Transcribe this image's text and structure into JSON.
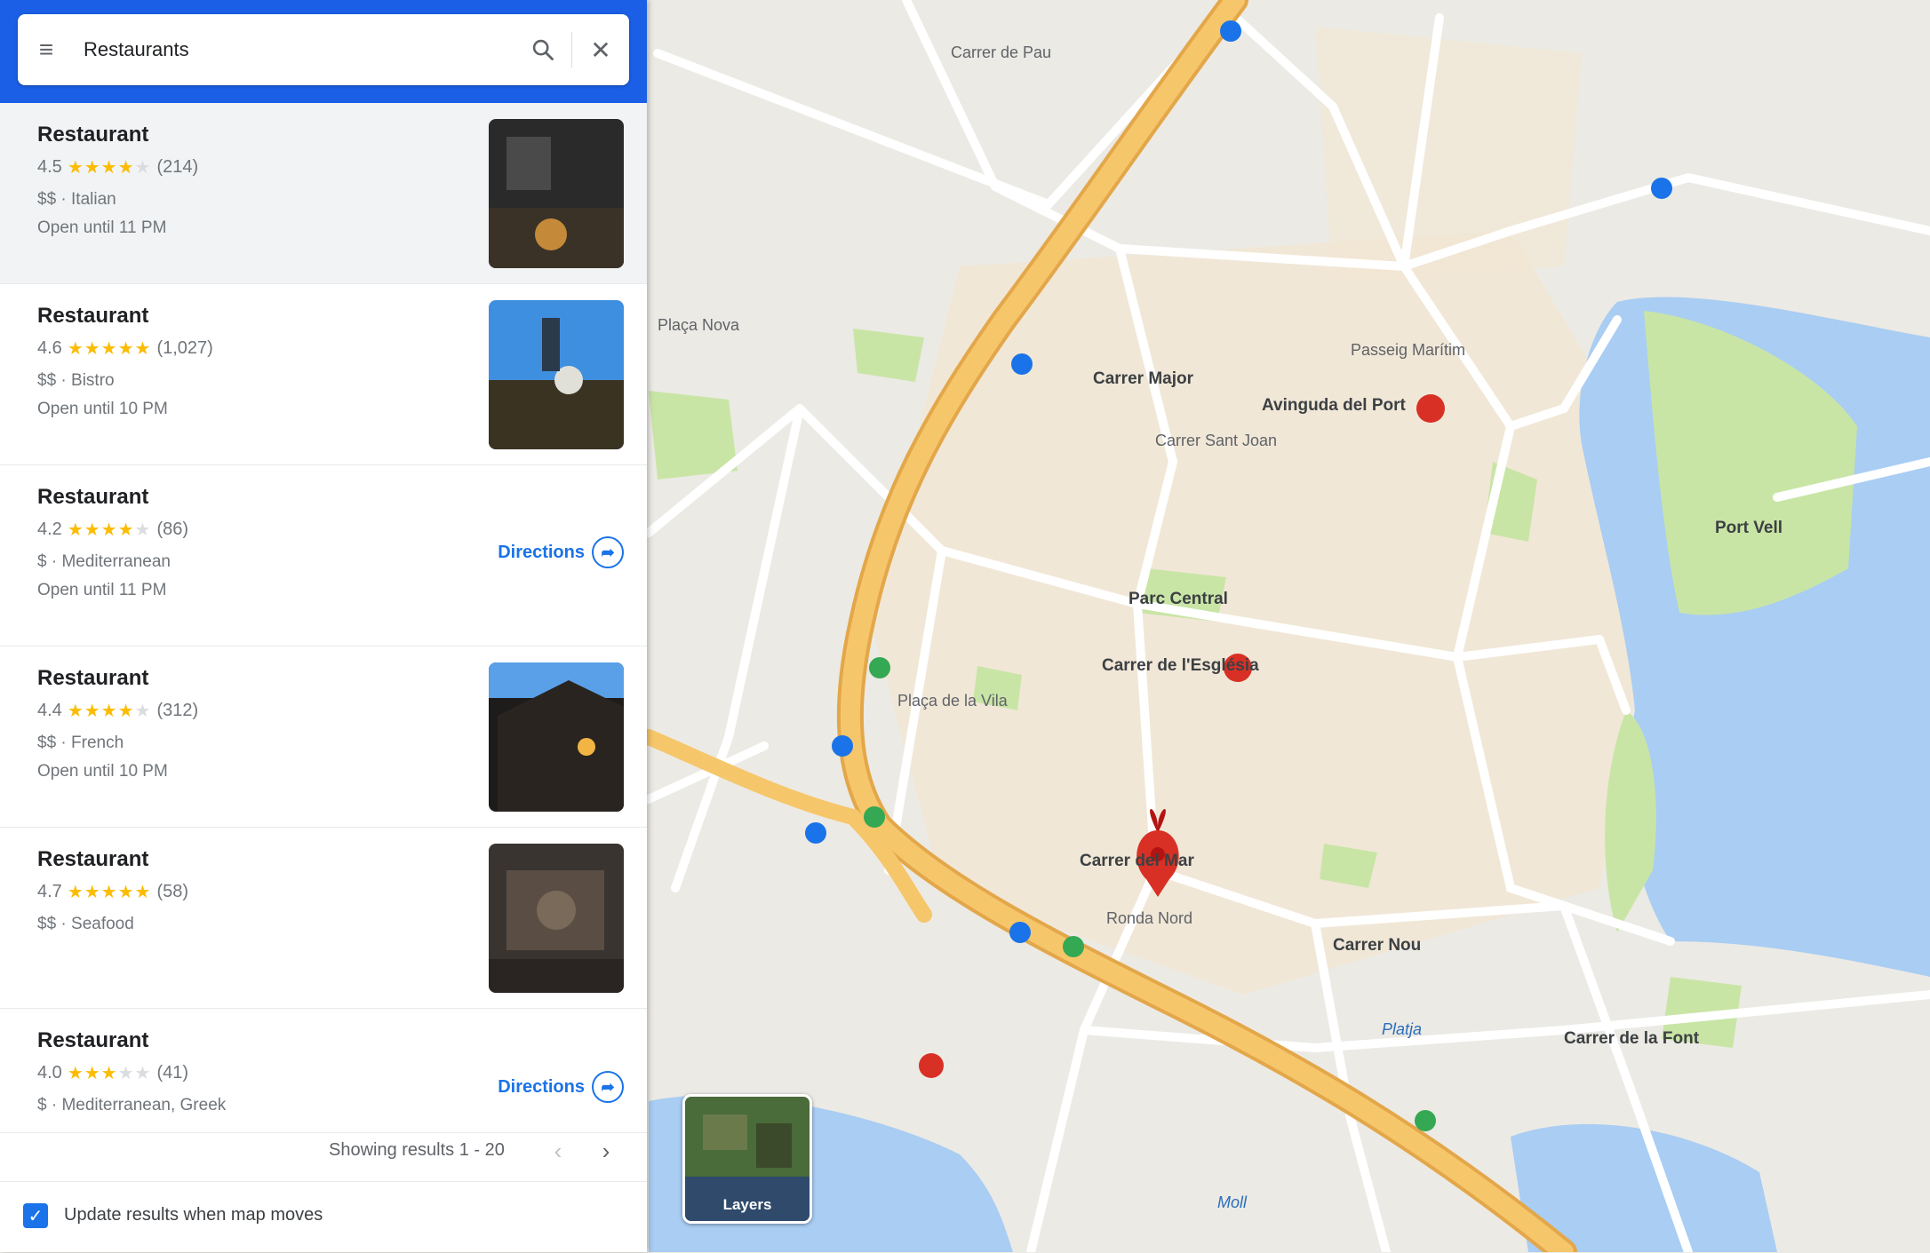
{
  "search": {
    "value": "Restaurants",
    "menu_icon": "menu-icon",
    "search_icon": "search-icon",
    "close_icon": "close-icon"
  },
  "results": [
    {
      "name": "Restaurant",
      "rating": "4.5",
      "stars": 4.5,
      "reviews": "(214)",
      "line1": "$$ · Italian",
      "line2": "Open until 11 PM",
      "has_photo": true,
      "photo_tone": "dark"
    },
    {
      "name": "Restaurant",
      "rating": "4.6",
      "stars": 5,
      "reviews": "(1,027)",
      "line1": "$$ · Bistro",
      "line2": "Open until 10 PM",
      "has_photo": true,
      "photo_tone": "sky"
    },
    {
      "name": "Restaurant",
      "rating": "4.2",
      "stars": 4,
      "reviews": "(86)",
      "line1": "$ · Mediterranean",
      "line2": "Open until 11 PM",
      "has_photo": false,
      "directions_label": "Directions"
    },
    {
      "name": "Restaurant",
      "rating": "4.4",
      "stars": 4.5,
      "reviews": "(312)",
      "line1": "$$ · French",
      "line2": "Open until 10 PM",
      "has_photo": true,
      "photo_tone": "night"
    },
    {
      "name": "Restaurant",
      "rating": "4.7",
      "stars": 5,
      "reviews": "(58)",
      "line1": "$$ · Seafood",
      "line2": "",
      "has_photo": true,
      "photo_tone": "warm"
    },
    {
      "name": "Restaurant",
      "rating": "4.0",
      "stars": 3.5,
      "reviews": "(41)",
      "line1": "$ · Mediterranean, Greek",
      "line2": "",
      "has_photo": false,
      "directions_label": "Directions"
    }
  ],
  "pagination": {
    "label": "Showing results 1 - 20",
    "prev_icon": "chevron-left-icon",
    "next_icon": "chevron-right-icon"
  },
  "bottom": {
    "update_label": "Update results when map moves",
    "checked": true
  },
  "map": {
    "layers_label": "Layers",
    "labels": [
      "Carrer de Pau",
      "Plaça Nova",
      "Carrer Major",
      "Avinguda del Port",
      "Passeig Marítim",
      "Carrer Sant Joan",
      "Parc Central",
      "Carrer de l'Església",
      "Plaça de la Vila",
      "Carrer del Mar",
      "Ronda Nord",
      "Carrer Nou",
      "Platja",
      "Moll",
      "Carrer de la Font",
      "Port Vell"
    ],
    "colors": {
      "land": "#eceae4",
      "road": "#ffffff",
      "highway": "#f6c66a",
      "highway_edge": "#e3a74a",
      "water": "#a9cdf3",
      "park": "#c9e5a6",
      "marker_red": "#d93025",
      "transit_blue": "#1a73e8",
      "accent": "#1a5fe6"
    }
  }
}
